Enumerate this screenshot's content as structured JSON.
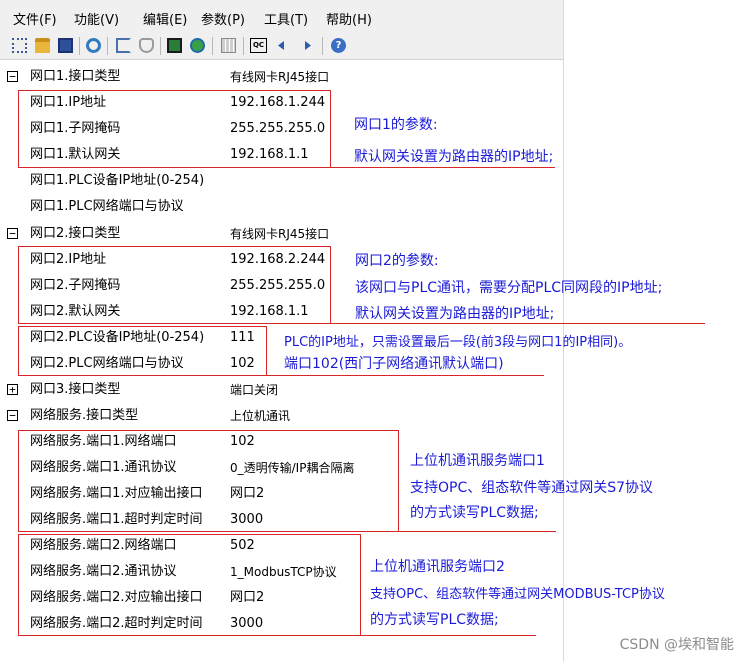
{
  "menu": [
    "文件(F)",
    "功能(V)",
    "编辑(E)",
    "参数(P)",
    "工具(T)",
    "帮助(H)"
  ],
  "toolbar": {
    "icons": [
      "network-icon",
      "open-folder-icon",
      "save-icon",
      "refresh-icon",
      "network-scan-icon",
      "filter-icon",
      "monitor-icon",
      "globe-icon",
      "keyboard-icon",
      "qc-icon",
      "arrow-left-icon",
      "arrow-right-icon",
      "help-icon"
    ],
    "qc_label": "QC"
  },
  "tree": [
    {
      "label": "网口1.接口类型",
      "value": "有线网卡RJ45接口",
      "expander": "−"
    },
    {
      "label": "网口1.IP地址",
      "value": "192.168.1.244"
    },
    {
      "label": "网口1.子网掩码",
      "value": "255.255.255.0"
    },
    {
      "label": "网口1.默认网关",
      "value": "192.168.1.1"
    },
    {
      "label": "网口1.PLC设备IP地址(0-254)",
      "value": ""
    },
    {
      "label": "网口1.PLC网络端口与协议",
      "value": ""
    },
    {
      "label": "网口2.接口类型",
      "value": "有线网卡RJ45接口",
      "expander": "−"
    },
    {
      "label": "网口2.IP地址",
      "value": "192.168.2.244"
    },
    {
      "label": "网口2.子网掩码",
      "value": "255.255.255.0"
    },
    {
      "label": "网口2.默认网关",
      "value": "192.168.1.1"
    },
    {
      "label": "网口2.PLC设备IP地址(0-254)",
      "value": "111"
    },
    {
      "label": "网口2.PLC网络端口与协议",
      "value": "102"
    },
    {
      "label": "网口3.接口类型",
      "value": "端口关闭",
      "expander": "+"
    },
    {
      "label": "网络服务.接口类型",
      "value": "上位机通讯",
      "expander": "−"
    },
    {
      "label": "网络服务.端口1.网络端口",
      "value": "102"
    },
    {
      "label": "网络服务.端口1.通讯协议",
      "value": "0_透明传输/IP耦合隔离"
    },
    {
      "label": "网络服务.端口1.对应输出接口",
      "value": "网口2"
    },
    {
      "label": "网络服务.端口1.超时判定时间",
      "value": "3000"
    },
    {
      "label": "网络服务.端口2.网络端口",
      "value": "502"
    },
    {
      "label": "网络服务.端口2.通讯协议",
      "value": "1_ModbusTCP协议"
    },
    {
      "label": "网络服务.端口2.对应输出接口",
      "value": "网口2"
    },
    {
      "label": "网络服务.端口2.超时判定时间",
      "value": "3000"
    }
  ],
  "notes": {
    "port1": [
      "网口1的参数:",
      "默认网关设置为路由器的IP地址;"
    ],
    "port2": [
      "网口2的参数:",
      "该网口与PLC通讯，需要分配PLC同网段的IP地址;",
      "默认网关设置为路由器的IP地址;"
    ],
    "plc": [
      "PLC的IP地址，只需设置最后一段(前3段与网口1的IP相同)。",
      "端口102(西门子网络通讯默认端口)"
    ],
    "service1": [
      "上位机通讯服务端口1",
      "支持OPC、组态软件等通过网关S7协议",
      "的方式读写PLC数据;"
    ],
    "service2": [
      "上位机通讯服务端口2",
      "支持OPC、组态软件等通过网关MODBUS-TCP协议",
      "的方式读写PLC数据;"
    ]
  },
  "watermark": "CSDN @埃和智能",
  "colors": {
    "annotation_red": "#d9252a",
    "note_blue": "#1a1ad8"
  }
}
